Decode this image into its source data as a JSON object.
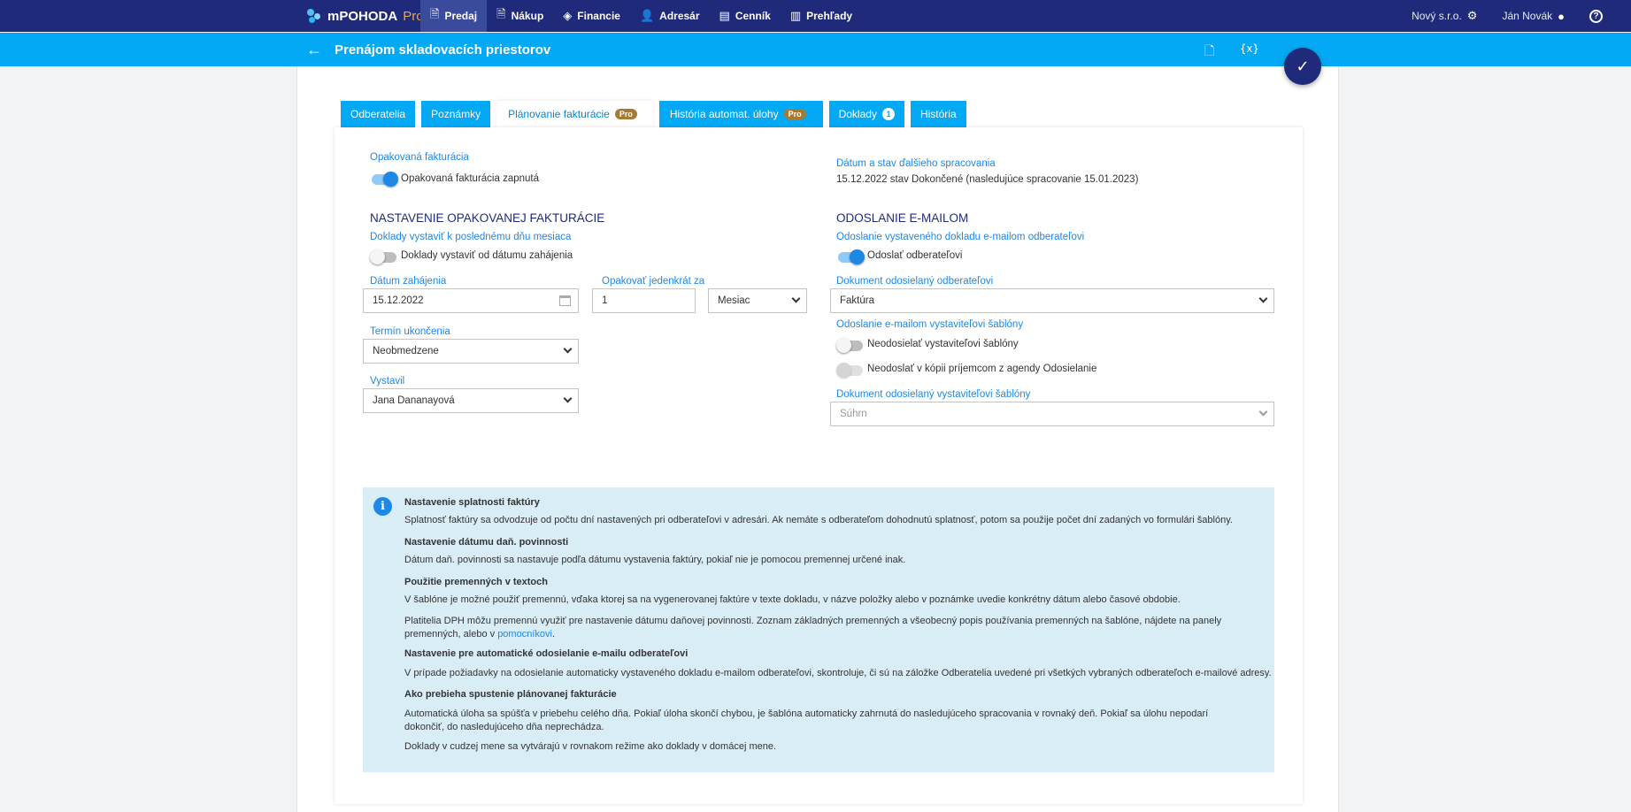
{
  "app": {
    "brand": "mPOHODA",
    "brand_suffix": "Pro"
  },
  "nav": [
    {
      "label": "Predaj",
      "icon": "invoice-icon",
      "active": true
    },
    {
      "label": "Nákup",
      "icon": "purchase-icon"
    },
    {
      "label": "Financie",
      "icon": "finance-icon"
    },
    {
      "label": "Adresár",
      "icon": "person-icon"
    },
    {
      "label": "Cenník",
      "icon": "pricelist-icon"
    },
    {
      "label": "Prehľady",
      "icon": "chart-icon"
    }
  ],
  "company": "Nový s.r.o.",
  "user": "Ján Novák",
  "page_title": "Prenájom skladovacích priestorov",
  "tabs": [
    {
      "label": "Odberatelia"
    },
    {
      "label": "Poznámky"
    },
    {
      "label": "Plánovanie fakturácie",
      "badge": "Pro",
      "active": true
    },
    {
      "label": "História automat. úlohy",
      "badge": "Pro"
    },
    {
      "label": "Doklady",
      "count": "1"
    },
    {
      "label": "História"
    }
  ],
  "left": {
    "repeat_label": "Opakovaná fakturácia",
    "repeat_toggle": "Opakovaná fakturácia zapnutá",
    "section_title": "NASTAVENIE OPAKOVANEJ FAKTURÁCIE",
    "last_day_label": "Doklady vystaviť k poslednému dňu mesiaca",
    "last_day_toggle": "Doklady vystaviť od dátumu zahájenia",
    "start_date_label": "Dátum zahájenia",
    "start_date_value": "15.12.2022",
    "repeat_every_label": "Opakovať jedenkrát za",
    "repeat_every_value": "1",
    "period_value": "Mesiac",
    "end_label": "Termín ukončenia",
    "end_value": "Neobmedzene",
    "issuer_label": "Vystavil",
    "issuer_value": "Jana Dananayová"
  },
  "right": {
    "next_label": "Dátum a stav ďalšieho spracovania",
    "next_value": "15.12.2022 stav Dokončené (nasledujúce spracovanie 15.01.2023)",
    "section_title": "ODOSLANIE E-MAILOM",
    "send_label": "Odoslanie vystaveného dokladu e-mailom odberateľovi",
    "send_toggle": "Odoslať odberateľovi",
    "doc_label": "Dokument odosielaný odberateľovi",
    "doc_value": "Faktúra",
    "tmpl_label": "Odoslanie e-mailom vystaviteľovi šablóny",
    "tmpl_toggle_1": "Neodosielať vystaviteľovi šablóny",
    "tmpl_toggle_2": "Neodoslať v kópii príjemcom z agendy Odosielanie",
    "tmpl_doc_label": "Dokument odosielaný vystaviteľovi šablóny",
    "tmpl_doc_value": "Súhrn"
  },
  "info": {
    "h1": "Nastavenie splatnosti faktúry",
    "p1": "Splatnosť faktúry sa odvodzuje od počtu dní nastavených pri odberateľovi v adresári. Ak nemáte s odberateľom dohodnutú splatnosť, potom sa použije počet dní zadaných vo formulári šablóny.",
    "h2": "Nastavenie dátumu daň. povinnosti",
    "p2": "Dátum daň. povinnosti sa nastavuje podľa dátumu vystavenia faktúry, pokiaľ nie je pomocou premennej určené inak.",
    "h3": "Použitie premenných v textoch",
    "p3": "V šablóne je možné použiť premennú, vďaka ktorej sa na vygenerovanej faktúre v texte dokladu, v názve položky alebo v poznámke uvedie konkrétny dátum alebo časové obdobie.",
    "p4": "Platitelia DPH môžu premennú využiť pre nastavenie dátumu daňovej povinnosti. Zoznam základných premenných a všeobecný popis používania premenných na šablóne, nájdete na panely premenných, alebo v",
    "p4_link": "pomocníkovi",
    "h4": "Nastavenie pre automatické odosielanie e-mailu odberateľovi",
    "p5": "V prípade požiadavky na odosielanie automaticky vystaveného dokladu e-mailom odberateľovi, skontroluje, či sú na záložke Odberatelia uvedené pri všetkých vybraných odberateľoch e-mailové adresy.",
    "h5": "Ako prebieha spustenie plánovanej fakturácie",
    "p6": "Automatická úloha sa spúšťa v priebehu celého dňa. Pokiaľ úloha skončí chybou, je šablóna automaticky zahrnutá do nasledujúceho spracovania v rovnaký deň. Pokiaľ sa úlohu nepodarí dokončiť, do nasledujúceho dňa neprechádza.",
    "p7": "Doklady v cudzej mene sa vytvárajú v rovnakom režime ako doklady v domácej mene."
  }
}
